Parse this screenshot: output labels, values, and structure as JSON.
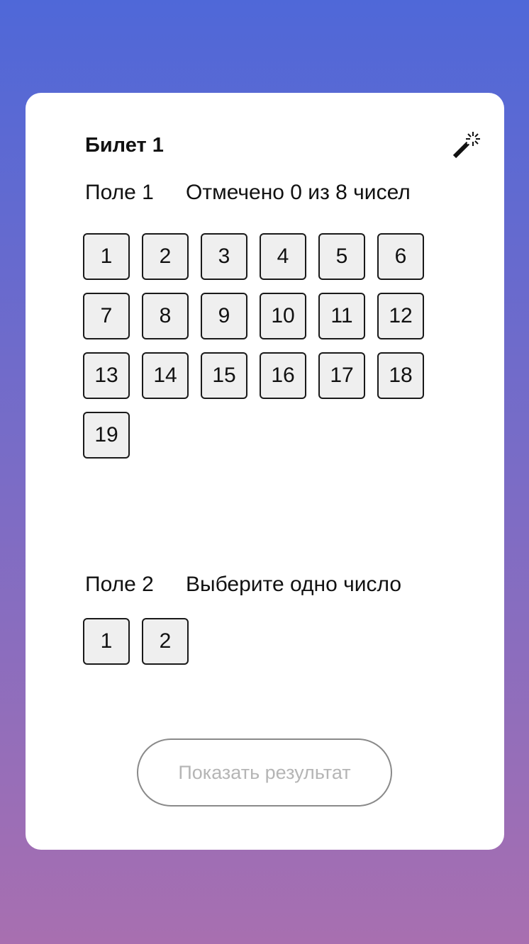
{
  "ticket": {
    "title": "Билет 1"
  },
  "icons": {
    "magic": "magic-wand-icon"
  },
  "field1": {
    "label": "Поле 1",
    "hint": "Отмечено 0 из 8 чисел",
    "numbers": [
      "1",
      "2",
      "3",
      "4",
      "5",
      "6",
      "7",
      "8",
      "9",
      "10",
      "11",
      "12",
      "13",
      "14",
      "15",
      "16",
      "17",
      "18",
      "19"
    ]
  },
  "field2": {
    "label": "Поле 2",
    "hint": "Выберите одно число",
    "numbers": [
      "1",
      "2"
    ]
  },
  "actions": {
    "show_result": "Показать результат"
  },
  "colors": {
    "gradient_top": "#4f68d8",
    "gradient_bottom": "#a86fb0",
    "cell_bg": "#efefef",
    "button_text_disabled": "#b5b5b5"
  }
}
